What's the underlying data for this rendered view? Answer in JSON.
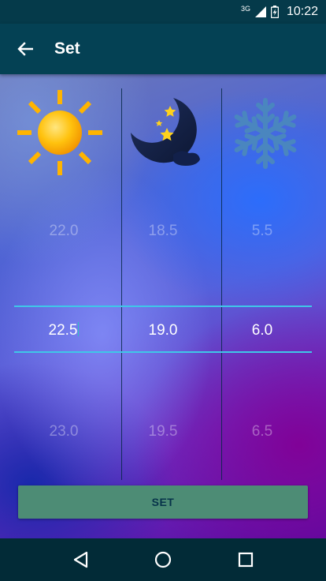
{
  "status_bar": {
    "network": "3G",
    "time": "10:22"
  },
  "app_bar": {
    "title": "Set"
  },
  "pickers": [
    {
      "name": "day",
      "above": "22.0",
      "current": "22.5",
      "below": "23.0"
    },
    {
      "name": "night",
      "above": "18.5",
      "current": "19.0",
      "below": "19.5"
    },
    {
      "name": "frost",
      "above": "5.5",
      "current": "6.0",
      "below": "6.5"
    }
  ],
  "set_button": {
    "label": "SET"
  },
  "colors": {
    "accent_line": "#3fc7e8",
    "button": "#4d8c75",
    "app_bar": "#044154"
  },
  "icons": {
    "day": "sun-icon",
    "night": "moon-stars-icon",
    "frost": "snowflake-icon"
  }
}
